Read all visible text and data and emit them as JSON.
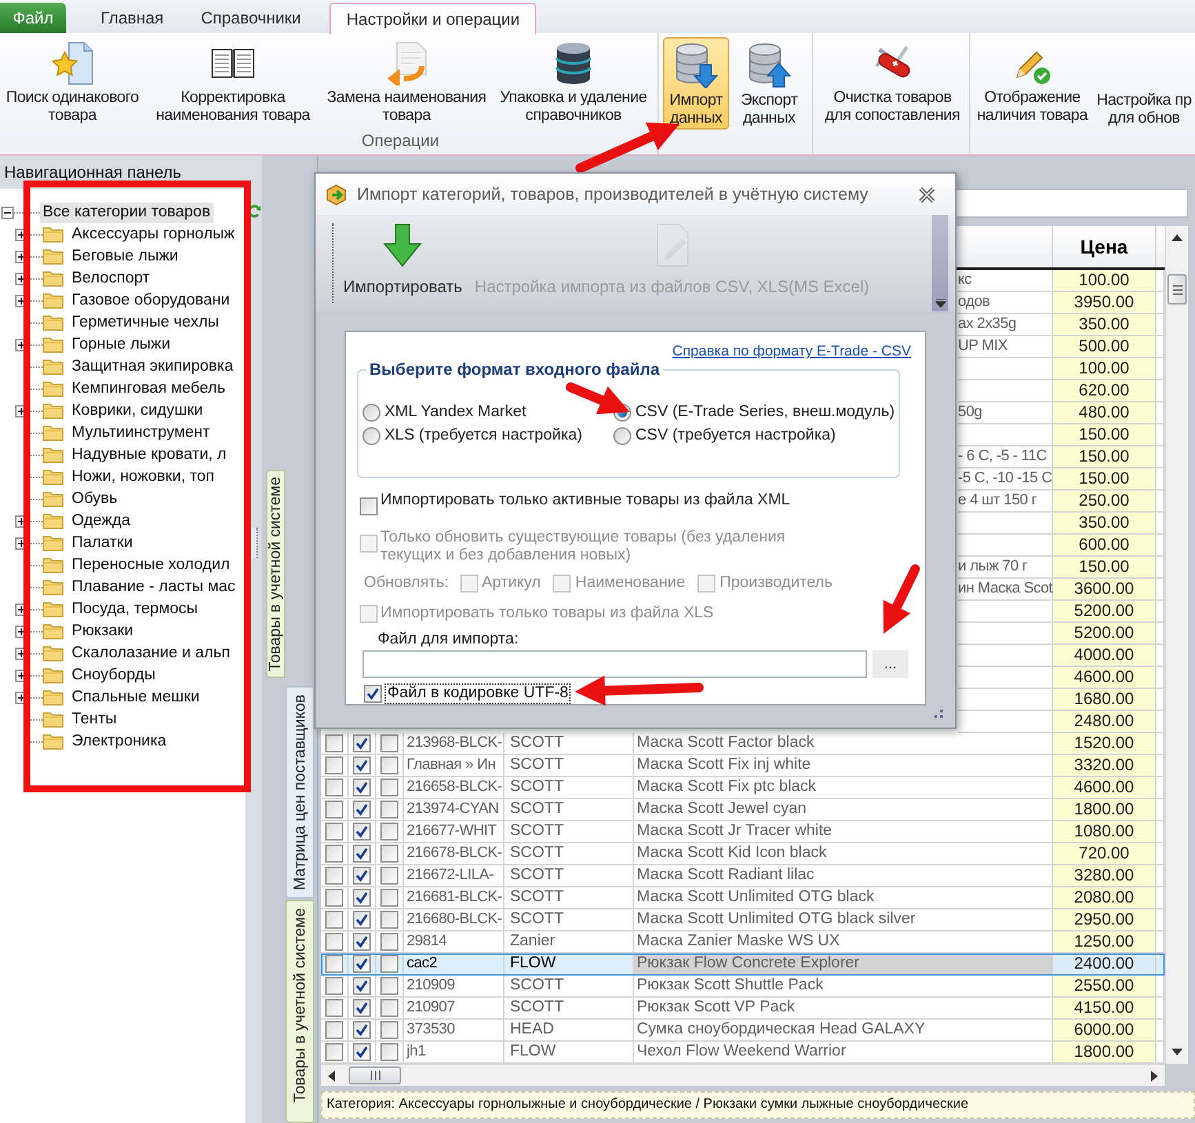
{
  "menu_tabs": [
    {
      "label": "Файл",
      "kind": "file",
      "selected": false
    },
    {
      "label": "Главная",
      "kind": "tab",
      "selected": false
    },
    {
      "label": "Справочники",
      "kind": "tab",
      "selected": false
    },
    {
      "label": "Настройки и операции",
      "kind": "tab",
      "selected": true
    }
  ],
  "ribbon": {
    "groups": [
      {
        "label": "Операции",
        "items": [
          {
            "label": "Поиск одинакового\nтовара",
            "highlighted": false
          },
          {
            "label": "Корректировка\nнаименования товара",
            "highlighted": false
          },
          {
            "label": "Замена наименования\nтовара",
            "highlighted": false
          },
          {
            "label": "Упаковка и удаление\nсправочников",
            "highlighted": false
          }
        ]
      },
      {
        "items": [
          {
            "label": "Импорт\nданных",
            "highlighted": true
          },
          {
            "label": "Экспорт\nданных",
            "highlighted": false
          }
        ]
      },
      {
        "items": [
          {
            "label": "Очистка товаров\nдля сопоставления",
            "highlighted": false
          }
        ]
      },
      {
        "items": [
          {
            "label": "Отображение\nналичия товара",
            "highlighted": false
          },
          {
            "label": "Настройка пр\nдля обнов",
            "highlighted": false
          }
        ]
      }
    ]
  },
  "navigation": {
    "title": "Навигационная панель",
    "tree": [
      {
        "label": "Все категории товаров",
        "expanded": true,
        "selected": true,
        "children": [
          {
            "label": "Аксессуары горнолыж",
            "expanded": false,
            "selected": false
          },
          {
            "label": "Беговые лыжи",
            "expanded": false,
            "selected": false
          },
          {
            "label": "Велоспорт",
            "expanded": false,
            "selected": false
          },
          {
            "label": "Газовое оборудовани",
            "expanded": false,
            "selected": false
          },
          {
            "label": "Герметичные чехлы",
            "selected": false
          },
          {
            "label": "Горные лыжи",
            "expanded": false,
            "selected": false
          },
          {
            "label": "Защитная экипировка",
            "selected": false
          },
          {
            "label": "Кемпинговая мебель",
            "selected": false
          },
          {
            "label": "Коврики, сидушки",
            "expanded": false,
            "selected": false
          },
          {
            "label": "Мультиинструмент",
            "selected": false
          },
          {
            "label": "Надувные кровати, л",
            "selected": false
          },
          {
            "label": "Ножи, ножовки, топ",
            "selected": false
          },
          {
            "label": "Обувь",
            "selected": false
          },
          {
            "label": "Одежда",
            "expanded": false,
            "selected": false
          },
          {
            "label": "Палатки",
            "expanded": false,
            "selected": false
          },
          {
            "label": "Переносные холодил",
            "selected": false
          },
          {
            "label": "Плавание - ласты мас",
            "selected": false
          },
          {
            "label": "Посуда, термосы",
            "expanded": false,
            "selected": false
          },
          {
            "label": "Рюкзаки",
            "expanded": false,
            "selected": false
          },
          {
            "label": "Скалолазание и альп",
            "expanded": false,
            "selected": false
          },
          {
            "label": "Сноуборды",
            "expanded": false,
            "selected": false
          },
          {
            "label": "Спальные мешки",
            "expanded": false,
            "selected": false
          },
          {
            "label": "Тенты",
            "selected": false
          },
          {
            "label": "Электроника",
            "selected": false
          }
        ]
      }
    ]
  },
  "side_tabs": [
    {
      "label": "Товары в учетной системе",
      "selected": true
    }
  ],
  "inner_tabs": [
    {
      "label": "Матрица цен поставщиков",
      "selected": false
    },
    {
      "label": "Товары в учетной системе",
      "selected": true
    }
  ],
  "table": {
    "price_header": "Цена",
    "rows": [
      {
        "name_tail": "кс",
        "price": "100.00",
        "selected": false
      },
      {
        "name_tail": "одов",
        "price": "3950.00",
        "selected": false
      },
      {
        "name_tail": "ax 2x35g",
        "price": "350.00",
        "selected": false
      },
      {
        "name_tail": "UP MIX",
        "price": "500.00",
        "selected": false
      },
      {
        "price": "100.00",
        "selected": false
      },
      {
        "price": "620.00",
        "selected": false
      },
      {
        "name_tail": "50g",
        "price": "480.00",
        "selected": false
      },
      {
        "price": "150.00",
        "selected": false
      },
      {
        "name_tail": "- 6 C, -5 - 11C",
        "price": "150.00",
        "selected": false
      },
      {
        "name_tail": "-5 C, -10 -15 C",
        "price": "150.00",
        "selected": false
      },
      {
        "name_tail": "е 4 шт 150 г",
        "price": "250.00",
        "selected": false
      },
      {
        "price": "350.00",
        "selected": false
      },
      {
        "price": "600.00",
        "selected": false
      },
      {
        "name_tail": "и лыж 70 г",
        "price": "150.00",
        "selected": false
      },
      {
        "name_tail": "ин Маска Scot",
        "price": "3600.00",
        "selected": false
      },
      {
        "price": "5200.00",
        "selected": false
      },
      {
        "price": "5200.00",
        "selected": false
      },
      {
        "price": "4000.00",
        "selected": false
      },
      {
        "price": "4600.00",
        "selected": false
      },
      {
        "price": "1680.00",
        "selected": false
      },
      {
        "price": "2480.00",
        "selected": false
      },
      {
        "checks": [
          false,
          true,
          false
        ],
        "code": "213968-BLCK-",
        "maker": "SCOTT",
        "name": "Маска Scott Factor black",
        "price": "1520.00",
        "selected": false
      },
      {
        "checks": [
          false,
          true,
          false
        ],
        "code": "Главная » Ин",
        "maker": "SCOTT",
        "name": "Маска Scott Fix inj white",
        "price": "3320.00",
        "selected": false
      },
      {
        "checks": [
          false,
          true,
          false
        ],
        "code": "216658-BLCK-",
        "maker": "SCOTT",
        "name": "Маска Scott Fix ptc black",
        "price": "4600.00",
        "selected": false
      },
      {
        "checks": [
          false,
          true,
          false
        ],
        "code": "213974-CYAN",
        "maker": "SCOTT",
        "name": "Маска Scott Jewel cyan",
        "price": "1800.00",
        "selected": false
      },
      {
        "checks": [
          false,
          true,
          false
        ],
        "code": "216677-WHIT",
        "maker": "SCOTT",
        "name": "Маска Scott Jr Tracer white",
        "price": "1080.00",
        "selected": false
      },
      {
        "checks": [
          false,
          true,
          false
        ],
        "code": "216678-BLCK-",
        "maker": "SCOTT",
        "name": "Маска Scott Kid Icon black",
        "price": "720.00",
        "selected": false
      },
      {
        "checks": [
          false,
          true,
          false
        ],
        "code": "216672-LILA-",
        "maker": "SCOTT",
        "name": "Маска Scott Radiant lilac",
        "price": "3280.00",
        "selected": false
      },
      {
        "checks": [
          false,
          true,
          false
        ],
        "code": "216681-BLCK-",
        "maker": "SCOTT",
        "name": "Маска Scott Unlimited OTG black",
        "price": "2080.00",
        "selected": false
      },
      {
        "checks": [
          false,
          true,
          false
        ],
        "code": "216680-BLCK-",
        "maker": "SCOTT",
        "name": "Маска Scott Unlimited OTG black silver",
        "price": "2950.00",
        "selected": false
      },
      {
        "checks": [
          false,
          true,
          false
        ],
        "code": "29814",
        "maker": "Zanier",
        "name": "Маска Zanier Maske WS UX",
        "price": "1250.00",
        "selected": false
      },
      {
        "checks": [
          false,
          true,
          false
        ],
        "code": "cac2",
        "maker": "FLOW",
        "name": "Рюкзак Flow Concrete Explorer",
        "price": "2400.00",
        "selected": true
      },
      {
        "checks": [
          false,
          true,
          false
        ],
        "code": "210909",
        "maker": "SCOTT",
        "name": "Рюкзак Scott Shuttle Pack",
        "price": "2550.00",
        "selected": false
      },
      {
        "checks": [
          false,
          true,
          false
        ],
        "code": "210907",
        "maker": "SCOTT",
        "name": "Рюкзак Scott VP Pack",
        "price": "4150.00",
        "selected": false
      },
      {
        "checks": [
          false,
          true,
          false
        ],
        "code": "373530",
        "maker": "HEAD",
        "name": "Сумка сноубордическая Head GALAXY",
        "price": "6000.00",
        "selected": false
      },
      {
        "checks": [
          false,
          true,
          false
        ],
        "code": "jh1",
        "maker": "FLOW",
        "name": "Чехол Flow Weekend Warrior",
        "price": "1800.00",
        "selected": false
      }
    ]
  },
  "status_bar": "Категория: Аксессуары горнолыжные и сноубордические / Рюкзаки сумки лыжные сноубордические",
  "dialog": {
    "title": "Импорт категорий, товаров, производителей в учётную систему",
    "toolbar": [
      {
        "label": "Импортировать",
        "disabled": false
      },
      {
        "label": "Настройка импорта из файлов CSV, XLS(MS Excel)",
        "disabled": true
      }
    ],
    "help_link": "Справка по формату E-Trade - CSV",
    "format_group": {
      "title": "Выберите формат входного файла",
      "options": [
        {
          "label": "XML Yandex Market",
          "selected": false
        },
        {
          "label": "CSV (E-Trade Series, внеш.модуль)",
          "selected": true
        },
        {
          "label": "XLS (требуется настройка)",
          "selected": false
        },
        {
          "label": "CSV (требуется настройка)",
          "selected": false
        }
      ]
    },
    "options": [
      {
        "label": "Импортировать только активные товары из файла XML",
        "checked": false,
        "disabled": false
      },
      {
        "label": "Только обновить существующие товары (без удаления\nтекущих и без добавления новых)",
        "checked": false,
        "disabled": true
      }
    ],
    "update": {
      "label": "Обновлять:",
      "disabled": true,
      "fields": [
        {
          "label": "Артикул",
          "checked": false
        },
        {
          "label": "Наименование",
          "checked": false
        },
        {
          "label": "Производитель",
          "checked": false
        }
      ]
    },
    "xls_only": {
      "label": "Импортировать только товары из файла XLS",
      "checked": false,
      "disabled": true
    },
    "file": {
      "label": "Файл для импорта:",
      "browse": "...",
      "utf8": {
        "label": "Файл в кодировке UTF-8",
        "checked": true,
        "focused": true
      }
    }
  }
}
